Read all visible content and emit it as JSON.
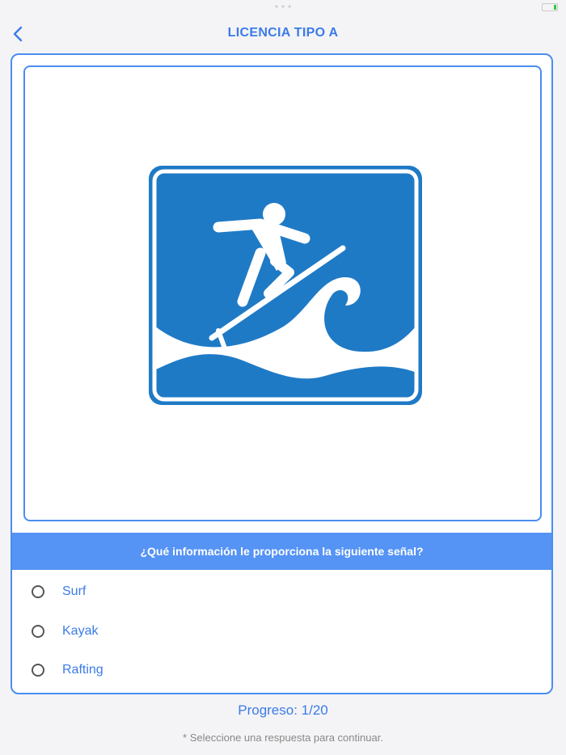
{
  "header": {
    "title": "LICENCIA TIPO A",
    "back_icon": "chevron-left-icon"
  },
  "question": {
    "image_icon": "surfing-sign-icon",
    "text": "¿Qué información le proporciona la siguiente señal?",
    "options": [
      {
        "label": "Surf"
      },
      {
        "label": "Kayak"
      },
      {
        "label": "Rafting"
      }
    ]
  },
  "footer": {
    "progress": "Progreso: 1/20",
    "hint": "* Seleccione una respuesta para continuar."
  },
  "colors": {
    "accent": "#3b7be8",
    "question_bar": "#5593f5",
    "sign_blue": "#1f7ac6"
  }
}
